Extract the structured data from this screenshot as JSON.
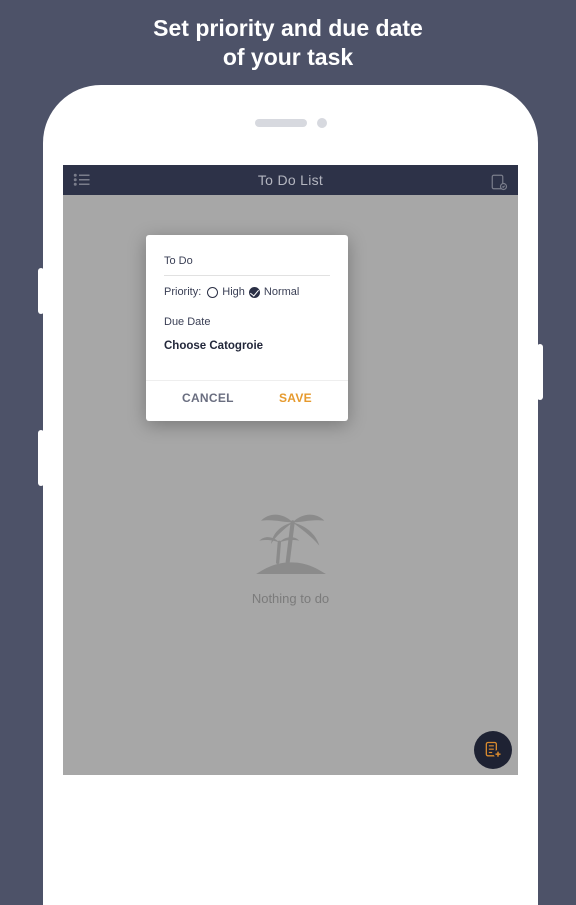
{
  "promo": {
    "line1": "Set priority and due date",
    "line2": "of your task"
  },
  "appbar": {
    "title": "To Do List"
  },
  "empty": {
    "text": "Nothing to do"
  },
  "modal": {
    "todo_label": "To Do",
    "priority_label": "Priority:",
    "priority_high": "High",
    "priority_normal": "Normal",
    "priority_selected": "normal",
    "due_date_label": "Due Date",
    "category_label": "Choose Catogroie",
    "cancel": "CANCEL",
    "save": "SAVE"
  }
}
